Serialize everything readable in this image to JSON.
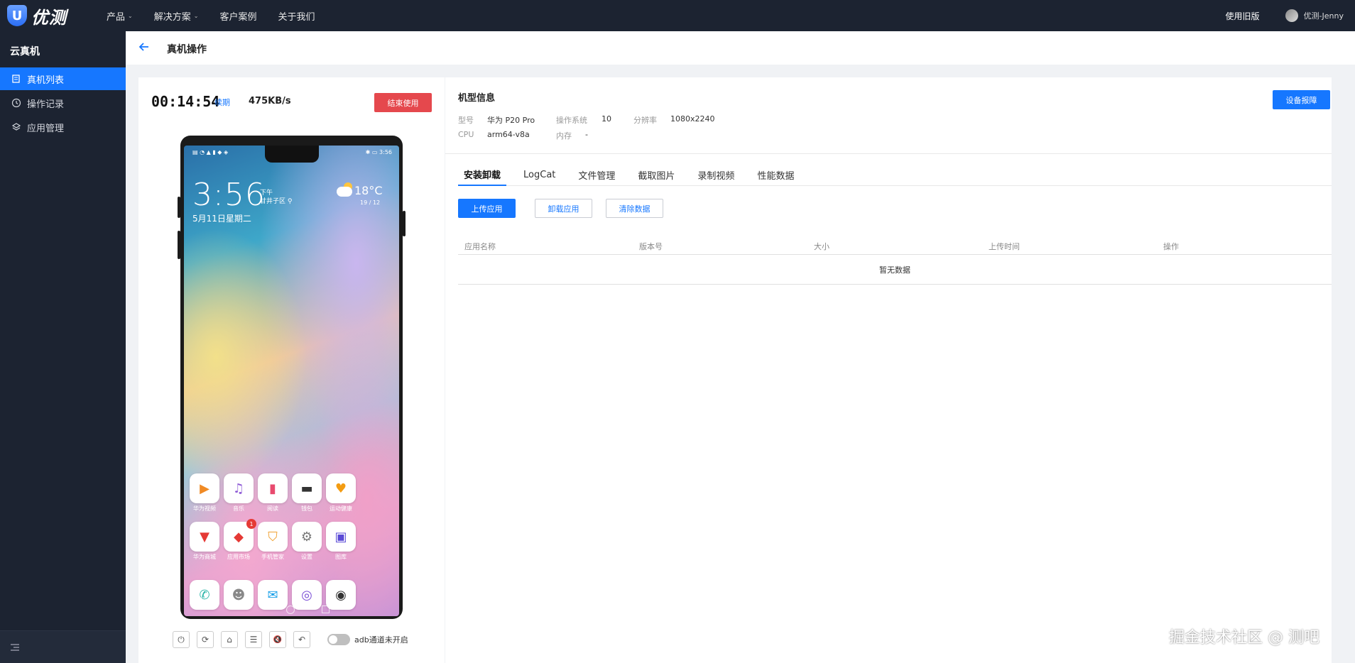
{
  "topbar": {
    "logo_text": "优测",
    "logo_mark": "U",
    "nav": [
      {
        "label": "产品",
        "has_dropdown": true
      },
      {
        "label": "解决方案",
        "has_dropdown": true
      },
      {
        "label": "客户案例",
        "has_dropdown": false
      },
      {
        "label": "关于我们",
        "has_dropdown": false
      }
    ],
    "old_version": "使用旧版",
    "username": "优测-Jenny"
  },
  "sidebar": {
    "title": "云真机",
    "items": [
      {
        "label": "真机列表",
        "icon": "list-icon",
        "active": true
      },
      {
        "label": "操作记录",
        "icon": "clock-icon",
        "active": false
      },
      {
        "label": "应用管理",
        "icon": "layers-icon",
        "active": false
      }
    ]
  },
  "header": {
    "title": "真机操作"
  },
  "session": {
    "timer": "00:14:54",
    "renew": "续期",
    "speed": "475KB/s",
    "end_button": "结束使用"
  },
  "phone": {
    "status_right": "3:56",
    "clock": "3:56",
    "ampm": "下午",
    "location": "甘井子区",
    "date": "5月11日星期二",
    "temp": "18°C",
    "temp_range": "19 / 12",
    "apps": [
      {
        "label": "华为视频",
        "glyph": "▶",
        "color": "#f08a24"
      },
      {
        "label": "音乐",
        "glyph": "♫",
        "color": "#8e5bd6"
      },
      {
        "label": "阅读",
        "glyph": "▮",
        "color": "#e84a6e"
      },
      {
        "label": "钱包",
        "glyph": "▬",
        "color": "#333333"
      },
      {
        "label": "运动健康",
        "glyph": "♥",
        "color": "#f39c12"
      },
      {
        "label": "华为商城",
        "glyph": "▼",
        "color": "#e53935"
      },
      {
        "label": "应用市场",
        "glyph": "◆",
        "color": "#e53935"
      },
      {
        "label": "手机管家",
        "glyph": "⛉",
        "color": "#f0a030"
      },
      {
        "label": "设置",
        "glyph": "⚙",
        "color": "#777777"
      },
      {
        "label": "图库",
        "glyph": "▣",
        "color": "#5b4bd6"
      }
    ],
    "badge": "1",
    "dock": [
      {
        "glyph": "✆",
        "color": "#2bb5a8"
      },
      {
        "glyph": "☻",
        "color": "#888888"
      },
      {
        "glyph": "✉",
        "color": "#1aa0e8"
      },
      {
        "glyph": "◎",
        "color": "#7b4fd6"
      },
      {
        "glyph": "◉",
        "color": "#333333"
      }
    ]
  },
  "controls": {
    "icons": [
      "power-icon",
      "rotate-icon",
      "home-icon",
      "menu-icon",
      "mute-icon",
      "back-icon"
    ],
    "glyphs": [
      "⏻",
      "⟳",
      "⌂",
      "☰",
      "🔇",
      "↶"
    ],
    "adb_label": "adb通道未开启"
  },
  "model": {
    "title": "机型信息",
    "fault_button": "设备报障",
    "labels": {
      "model": "型号",
      "os": "操作系统",
      "resolution": "分辨率",
      "cpu": "CPU",
      "memory": "内存"
    },
    "values": {
      "model": "华为 P20 Pro",
      "os": "10",
      "resolution": "1080x2240",
      "cpu": "arm64-v8a",
      "memory": "-"
    }
  },
  "tabs": [
    "安装卸载",
    "LogCat",
    "文件管理",
    "截取图片",
    "录制视频",
    "性能数据"
  ],
  "actions": {
    "upload": "上传应用",
    "uninstall": "卸载应用",
    "clear": "清除数据"
  },
  "table": {
    "headers": [
      "应用名称",
      "版本号",
      "大小",
      "上传时间",
      "操作"
    ],
    "empty_text": "暂无数据"
  },
  "watermark": "掘金技术社区 @ 测吧"
}
